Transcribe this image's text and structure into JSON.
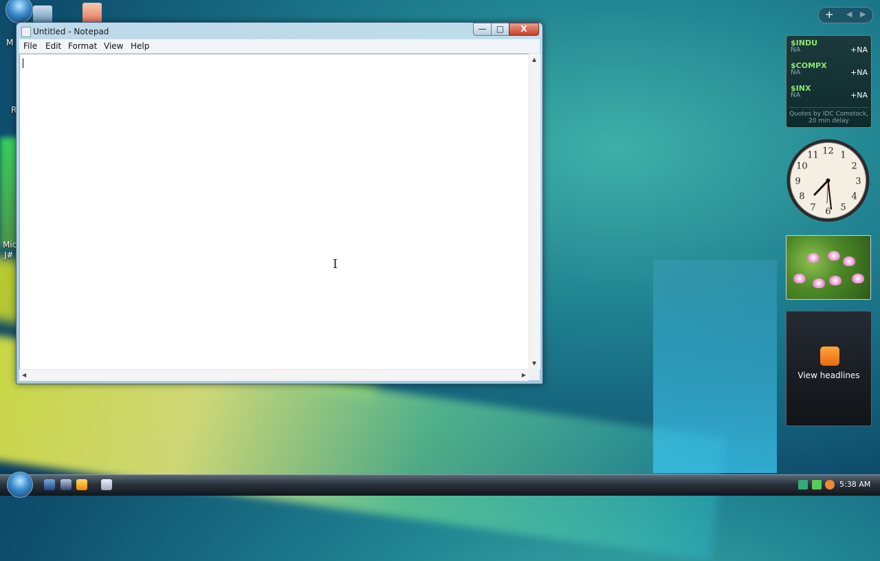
{
  "window": {
    "title": "Untitled - Notepad",
    "controls": {
      "minimize": "—",
      "maximize": "□",
      "close": "X"
    }
  },
  "menu": [
    "File",
    "Edit",
    "Format",
    "View",
    "Help"
  ],
  "editor": {
    "content": ""
  },
  "desktop": {
    "partial_labels": [
      "M",
      "R",
      "Mic",
      "J#"
    ]
  },
  "gadgets": {
    "stocks": [
      {
        "symbol": "$INDU",
        "value": "NA",
        "change": "+NA"
      },
      {
        "symbol": "$COMPX",
        "value": "NA",
        "change": "+NA"
      },
      {
        "symbol": "$INX",
        "value": "NA",
        "change": "+NA"
      }
    ],
    "stocks_note": "Quotes by IDC Comstock, 20 min delay",
    "clock_numbers": [
      "12",
      "1",
      "2",
      "3",
      "4",
      "5",
      "6",
      "7",
      "8",
      "9",
      "10",
      "11"
    ],
    "feed_label": "View headlines"
  },
  "taskbar": {
    "time": "5:38 AM"
  },
  "colors": {
    "stock_symbol": "#8fe86a",
    "close_button": "#c8402a"
  }
}
